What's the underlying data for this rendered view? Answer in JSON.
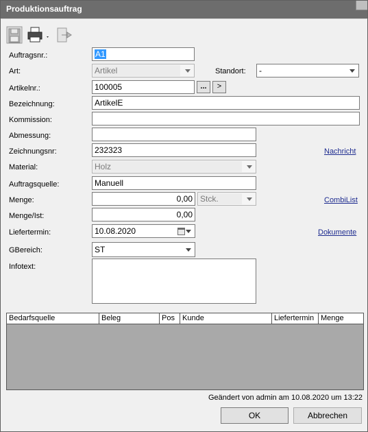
{
  "window": {
    "title": "Produktionsauftrag"
  },
  "toolbar": {
    "save_icon": "floppy-disk-icon",
    "print_icon": "printer-icon",
    "exit_icon": "exit-arrow-icon"
  },
  "form": {
    "auftragsnr": {
      "label": "Auftragsnr.:",
      "value": "A1"
    },
    "art": {
      "label": "Art:",
      "value": "Artikel"
    },
    "standort": {
      "label": "Standort:",
      "value": "-"
    },
    "artikelnr": {
      "label": "Artikelnr.:",
      "value": "100005",
      "browse_label": "...",
      "goto_label": ">"
    },
    "bezeichnung": {
      "label": "Bezeichnung:",
      "value": "ArtikelE"
    },
    "kommission": {
      "label": "Kommission:",
      "value": ""
    },
    "abmessung": {
      "label": "Abmessung:",
      "value": ""
    },
    "zeichnungsnr": {
      "label": "Zeichnungsnr:",
      "value": "232323"
    },
    "material": {
      "label": "Material:",
      "value": "Holz"
    },
    "auftragsquelle": {
      "label": "Auftragsquelle:",
      "value": "Manuell"
    },
    "menge": {
      "label": "Menge:",
      "value": "0,00",
      "unit": "Stck."
    },
    "menge_ist": {
      "label": "Menge/Ist:",
      "value": "0,00"
    },
    "liefertermin": {
      "label": "Liefertermin:",
      "value": "10.08.2020"
    },
    "gbereich": {
      "label": "GBereich:",
      "value": "ST"
    },
    "infotext": {
      "label": "Infotext:",
      "value": ""
    }
  },
  "links": {
    "nachricht": "Nachricht",
    "combilist": "CombiList",
    "dokumente": "Dokumente"
  },
  "grid": {
    "columns": [
      "Bedarfsquelle",
      "Beleg",
      "Pos",
      "Kunde",
      "Liefertermin",
      "Menge"
    ]
  },
  "status": {
    "text": "Geändert von admin am 10.08.2020 um 13:22"
  },
  "buttons": {
    "ok": "OK",
    "cancel": "Abbrechen"
  }
}
